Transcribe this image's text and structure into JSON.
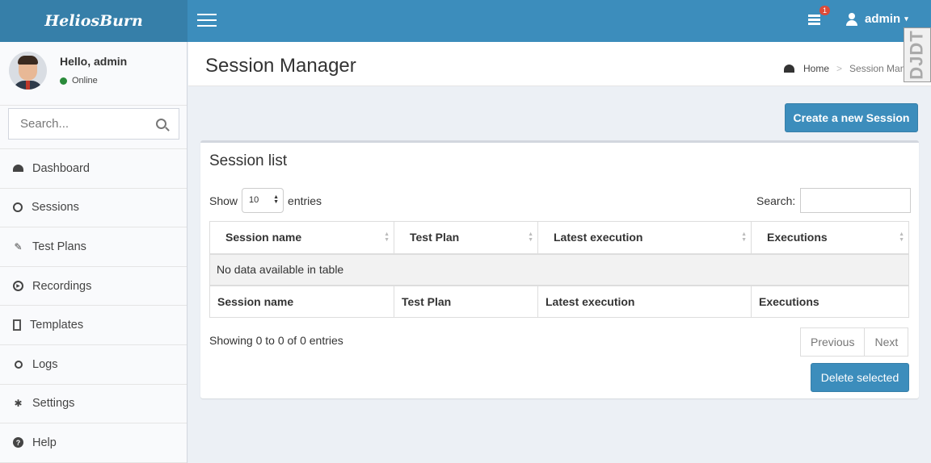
{
  "app": {
    "logo": "HeliosBurn"
  },
  "header": {
    "notification_count": "1",
    "user_label": "admin",
    "caret": "▾"
  },
  "sidebar": {
    "greeting": "Hello, admin",
    "status": "Online",
    "search_placeholder": "Search...",
    "items": [
      {
        "label": "Dashboard",
        "icon": "dashboard-icon"
      },
      {
        "label": "Sessions",
        "icon": "clock-icon"
      },
      {
        "label": "Test Plans",
        "icon": "pencil-icon"
      },
      {
        "label": "Recordings",
        "icon": "play-circle-icon"
      },
      {
        "label": "Templates",
        "icon": "document-icon"
      },
      {
        "label": "Logs",
        "icon": "search-icon"
      },
      {
        "label": "Settings",
        "icon": "gear-icon"
      },
      {
        "label": "Help",
        "icon": "question-circle-icon"
      }
    ]
  },
  "page": {
    "title": "Session Manager",
    "breadcrumb": {
      "home": "Home",
      "current": "Session Manag"
    },
    "watermark": "DJDT",
    "create_button": "Create a new Session"
  },
  "session_list": {
    "title": "Session list",
    "show_label": "Show",
    "page_size": "10",
    "entries_label": "entries",
    "search_label": "Search:",
    "columns": [
      "Session name",
      "Test Plan",
      "Latest execution",
      "Executions"
    ],
    "empty_message": "No data available in table",
    "info": "Showing 0 to 0 of 0 entries",
    "previous": "Previous",
    "next": "Next",
    "delete_button": "Delete selected"
  },
  "colors": {
    "header": "#3c8dbc",
    "logo_bg": "#367fa9",
    "badge": "#dd4b39",
    "online": "#2a8a3a"
  }
}
